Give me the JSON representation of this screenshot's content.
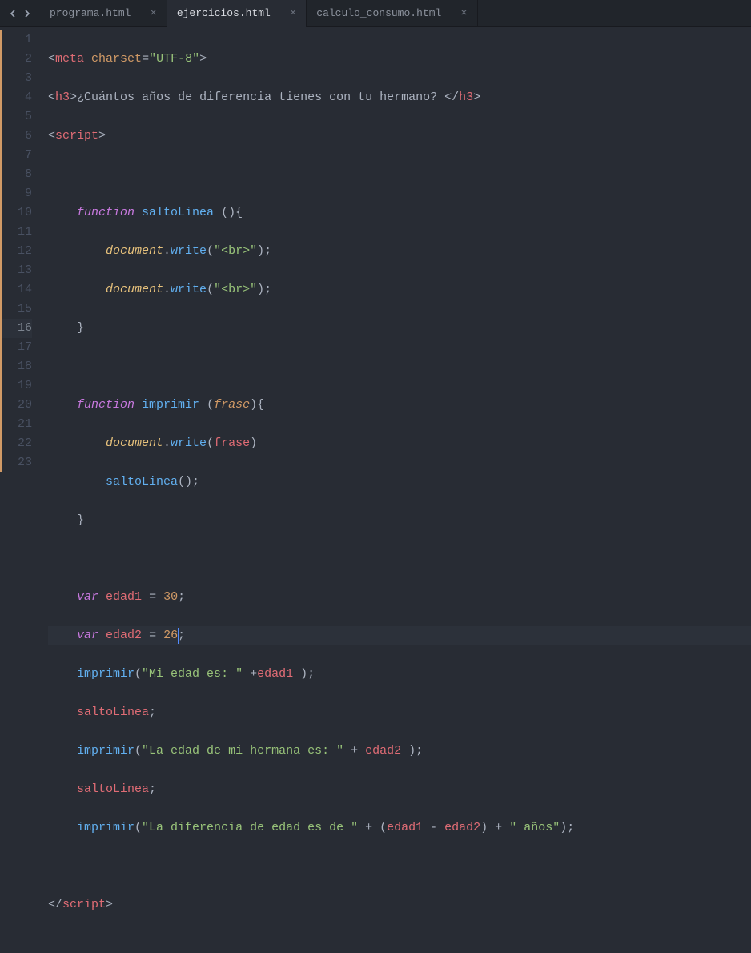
{
  "tabs": [
    {
      "name": "programa.html",
      "active": false
    },
    {
      "name": "ejercicios.html",
      "active": true
    },
    {
      "name": "calculo_consumo.html",
      "active": false
    }
  ],
  "gutter": {
    "start": 1,
    "end": 23,
    "current": 16
  },
  "code": {
    "line1": {
      "open": "<",
      "tag": "meta",
      "attr": "charset",
      "eq": "=",
      "val": "\"UTF-8\"",
      "close": ">"
    },
    "line2": {
      "openH3": "<",
      "h3": "h3",
      "gt": ">",
      "text": "¿Cuántos años de diferencia tienes con tu hermano? ",
      "closeLt": "</",
      "h3c": "h3",
      "closeGt": ">"
    },
    "line3": {
      "lt": "<",
      "tag": "script",
      "gt": ">"
    },
    "line5": {
      "kw": "function",
      "name": "saltoLinea",
      "parens": " ()",
      "brace": "{"
    },
    "line6": {
      "obj": "document",
      "dot": ".",
      "fn": "write",
      "lp": "(",
      "str": "\"<br>\"",
      "rp": ")",
      "semi": ";"
    },
    "line7": {
      "obj": "document",
      "dot": ".",
      "fn": "write",
      "lp": "(",
      "str": "\"<br>\"",
      "rp": ")",
      "semi": ";"
    },
    "line8": {
      "brace": "}"
    },
    "line10": {
      "kw": "function",
      "name": "imprimir",
      "lp": " (",
      "param": "frase",
      "rp": ")",
      "brace": "{"
    },
    "line11": {
      "obj": "document",
      "dot": ".",
      "fn": "write",
      "lp": "(",
      "arg": "frase",
      "rp": ")"
    },
    "line12": {
      "fn": "saltoLinea",
      "parens": "()",
      "semi": ";"
    },
    "line13": {
      "brace": "}"
    },
    "line15": {
      "kw": "var",
      "name": "edad1",
      "eq": " = ",
      "num": "30",
      "semi": ";"
    },
    "line16": {
      "kw": "var",
      "name": "edad2",
      "eq": " = ",
      "num": "26",
      "semi": ";"
    },
    "line17": {
      "fn": "imprimir",
      "lp": "(",
      "str": "\"Mi edad es: \"",
      "plus": " +",
      "var": "edad1",
      "sp": " ",
      "rp": ")",
      "semi": ";"
    },
    "line18": {
      "ident": "saltoLinea",
      "semi": ";"
    },
    "line19": {
      "fn": "imprimir",
      "lp": "(",
      "str": "\"La edad de mi hermana es: \"",
      "plus": " + ",
      "var": "edad2",
      "sp": " ",
      "rp": ")",
      "semi": ";"
    },
    "line20": {
      "ident": "saltoLinea",
      "semi": ";"
    },
    "line21": {
      "fn": "imprimir",
      "lp": "(",
      "str1": "\"La diferencia de edad es de \"",
      "plus1": " + (",
      "v1": "edad1",
      "minus": " - ",
      "v2": "edad2",
      "rp1": ")",
      "plus2": " + ",
      "str2": "\" años\"",
      "rp": ")",
      "semi": ";"
    },
    "line23": {
      "lt": "</",
      "tag": "script",
      "gt": ">"
    }
  }
}
